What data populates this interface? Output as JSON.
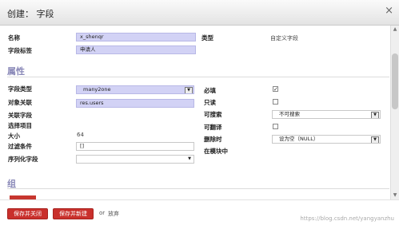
{
  "dialog": {
    "title": "创建： 字段",
    "close_glyph": "×"
  },
  "fields_top": {
    "name_label": "名称",
    "name_value": "x_shenqr",
    "field_label_label": "字段标签",
    "field_label_value": "申请人",
    "type_label": "类型",
    "type_value": "自定义字段"
  },
  "properties": {
    "section_title": "属性",
    "field_type_label": "字段类型",
    "field_type_value": "many2one",
    "relation_label": "对象关联",
    "relation_value": "res.users",
    "relation_field_label": "关联字段",
    "selection_label": "选择项目",
    "size_label": "大小",
    "size_value": "64",
    "domain_label": "过滤条件",
    "domain_value": "[]",
    "serialization_label": "序列化字段",
    "required_label": "必填",
    "required_checked": true,
    "readonly_label": "只读",
    "readonly_checked": false,
    "searchable_label": "可搜索",
    "searchable_value": "不可搜索",
    "translatable_label": "可翻译",
    "translatable_checked": false,
    "on_delete_label": "删除时",
    "on_delete_value": "设为空（NULL）",
    "in_modules_label": "在模块中"
  },
  "groups": {
    "section_title": "组"
  },
  "footer": {
    "save_close": "保存并关闭",
    "save_new": "保存并新建",
    "or": "or",
    "discard": "放弃"
  },
  "watermark": "https://blog.csdn.net/yangyanzhu",
  "colors": {
    "required_bg": "#d2d2f5",
    "button_bg": "#c9302c",
    "section_title": "#8a89b8"
  }
}
